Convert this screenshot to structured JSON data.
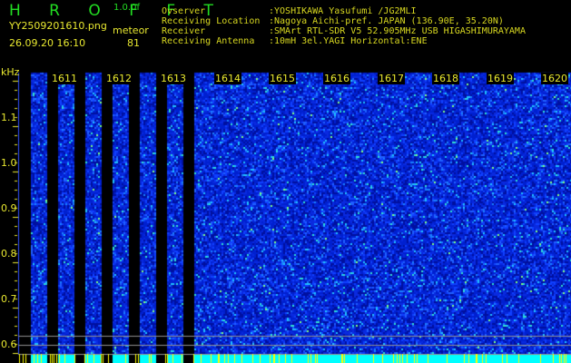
{
  "header": {
    "app_title": "H R O F F T",
    "version": "1.0.0f",
    "filename": "YY2509201610.png",
    "datetime": "26.09.20 16:10",
    "mode_label": "meteor",
    "count": "81",
    "info": [
      {
        "label": "Ovserver",
        "value": ":YOSHIKAWA Yasufumi /JG2MLI"
      },
      {
        "label": "Receiving Location",
        "value": ":Nagoya Aichi-pref. JAPAN (136.90E, 35.20N)"
      },
      {
        "label": "Receiver",
        "value": ":SMArt RTL-SDR V5 52.905MHz USB HIGASHIMURAYAMA"
      },
      {
        "label": "Receiving Antenna",
        "value": ":10mH 3el.YAGI Horizontal:ENE"
      }
    ]
  },
  "spectrogram": {
    "y_unit": "kHz",
    "y_ticks": [
      "1.1",
      "1.0",
      "0.9",
      "0.8",
      "0.7",
      "0.6"
    ],
    "time_labels": [
      "1611",
      "1612",
      "1613",
      "1614",
      "1615",
      "1616",
      "1617",
      "1618",
      "1619",
      "1620"
    ],
    "colors": {
      "background": "#000000",
      "noise": "#0a2adf",
      "signal": "#00ffff",
      "label": "#e8e830",
      "title": "#22dd22"
    }
  }
}
